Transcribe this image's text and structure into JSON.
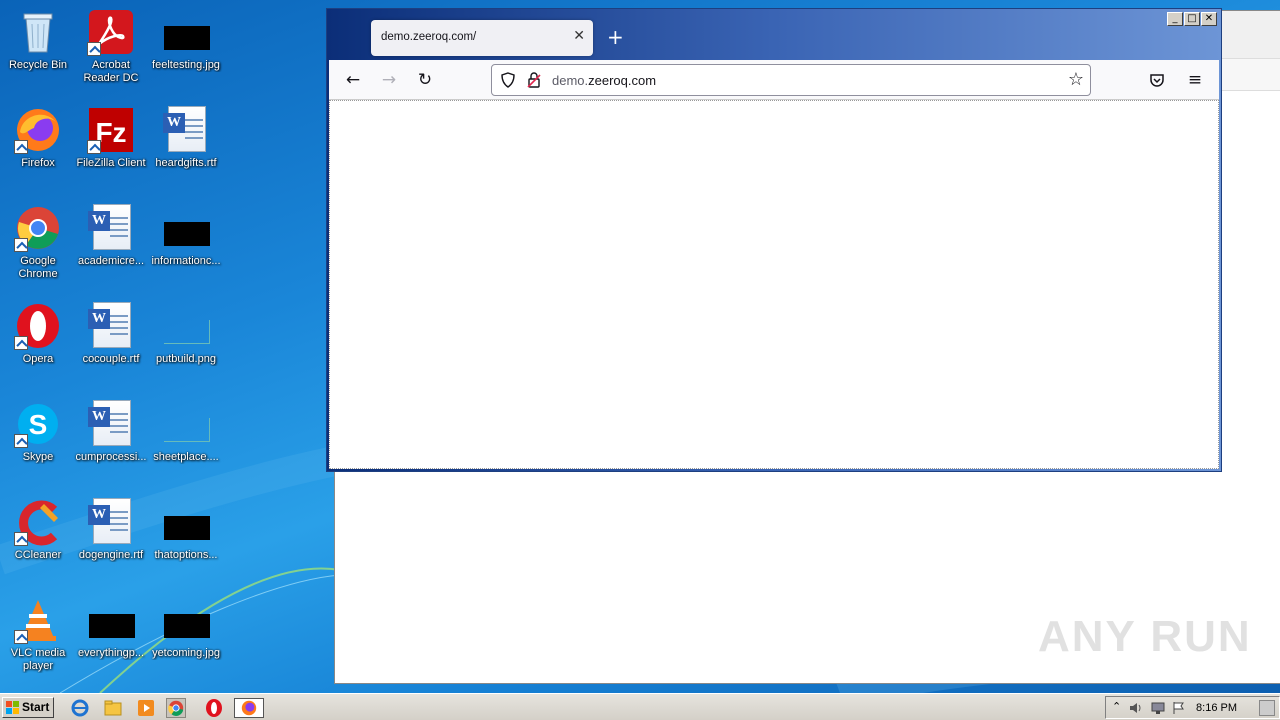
{
  "desktop": {
    "icons": [
      {
        "label": "Recycle Bin"
      },
      {
        "label": "Acrobat Reader DC"
      },
      {
        "label": "feeltesting.jpg"
      },
      {
        "label": "Firefox"
      },
      {
        "label": "FileZilla Client"
      },
      {
        "label": "heardgifts.rtf"
      },
      {
        "label": "Google Chrome"
      },
      {
        "label": "academicre..."
      },
      {
        "label": "informationc..."
      },
      {
        "label": "Opera"
      },
      {
        "label": "cocouple.rtf"
      },
      {
        "label": "putbuild.png"
      },
      {
        "label": "Skype"
      },
      {
        "label": "cumprocessi..."
      },
      {
        "label": "sheetplace...."
      },
      {
        "label": "CCleaner"
      },
      {
        "label": "dogengine.rtf"
      },
      {
        "label": "thatoptions..."
      },
      {
        "label": "VLC media player"
      },
      {
        "label": "everythingp..."
      },
      {
        "label": "yetcoming.jpg"
      }
    ]
  },
  "browser": {
    "tab_title": "demo.zeeroq.com/",
    "tab_close": "✕",
    "new_tab": "+",
    "url_host_prefix": "demo.",
    "url_host_main": "zeeroq.com",
    "back": "←",
    "forward": "→",
    "reload": "↻",
    "bookmark": "☆",
    "menu": "≡"
  },
  "window_controls": {
    "minimize": "_",
    "maximize": "□",
    "close": "✕"
  },
  "watermark": "ANY RUN",
  "taskbar": {
    "start_label": "Start",
    "clock": "8:16 PM"
  },
  "colors": {
    "desktop_bg": "#1a86d8",
    "browser_title_gradient_start": "#0b2e78",
    "browser_title_gradient_end": "#6d95d6",
    "taskbar_bg": "#d4d0c8"
  }
}
